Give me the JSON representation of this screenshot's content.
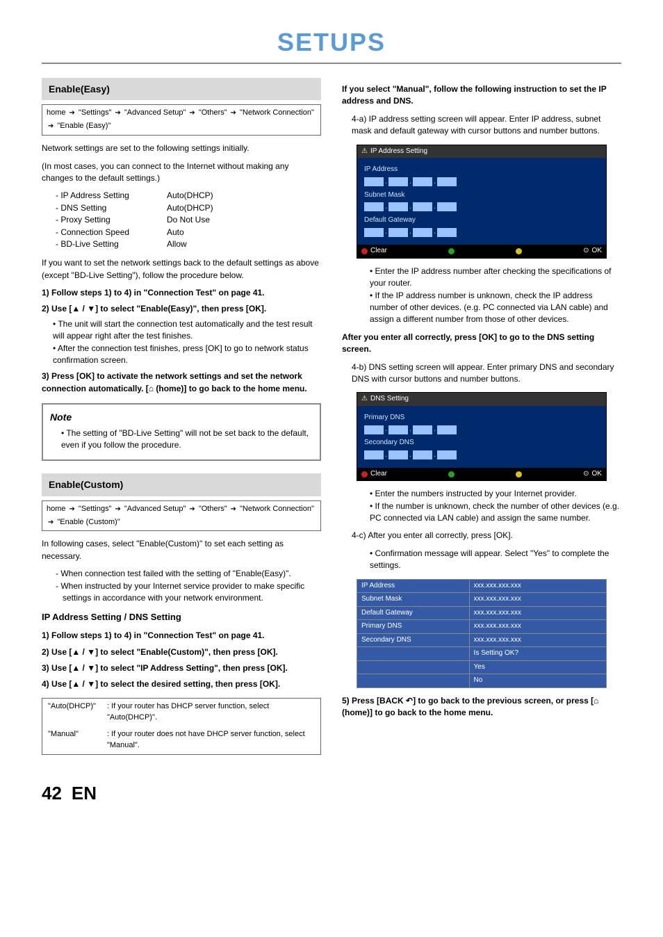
{
  "page": {
    "title": "SETUPS",
    "number": "42",
    "lang": "EN"
  },
  "left": {
    "sec1": {
      "header": "Enable(Easy)",
      "crumb": [
        "home",
        "\"Settings\"",
        "\"Advanced Setup\"",
        "\"Others\"",
        "\"Network Connection\"",
        "\"Enable (Easy)\""
      ],
      "intro1": "Network settings are set to the following settings initially.",
      "intro2": "(In most cases, you can connect to the Internet without making any changes to the default settings.)",
      "defaults": [
        {
          "n": "- IP Address Setting",
          "v": "Auto(DHCP)"
        },
        {
          "n": "- DNS Setting",
          "v": "Auto(DHCP)"
        },
        {
          "n": "- Proxy Setting",
          "v": "Do Not Use"
        },
        {
          "n": "- Connection Speed",
          "v": "Auto"
        },
        {
          "n": "- BD-Live Setting",
          "v": "Allow"
        }
      ],
      "reset": "If you want to set the network settings back to the default settings as above (except \"BD-Live Setting\"), follow the procedure below.",
      "step1": "1)  Follow steps 1) to 4) in \"Connection Test\" on page 41.",
      "step2": "2)  Use [▲ / ▼] to select \"Enable(Easy)\", then press [OK].",
      "step2_bullets": [
        "The unit will start the connection test automatically and the test result will appear right after the test finishes.",
        "After the connection test finishes, press [OK] to go to network status confirmation screen."
      ],
      "step3": "3)  Press [OK] to activate the network settings and set the network connection automatically. [⌂ (home)] to go back to the home menu.",
      "note_title": "Note",
      "note_body": "The setting of \"BD-Live Setting\" will not be set back to the default, even if you follow the procedure."
    },
    "sec2": {
      "header": "Enable(Custom)",
      "crumb": [
        "home",
        "\"Settings\"",
        "\"Advanced Setup\"",
        "\"Others\"",
        "\"Network Connection\"",
        "\"Enable (Custom)\""
      ],
      "intro": "In following cases, select \"Enable(Custom)\" to set each setting as necessary.",
      "cases": [
        "- When connection test failed with the setting of \"Enable(Easy)\".",
        "- When instructed by your Internet service provider to make specific settings in accordance with your network environment."
      ],
      "subhead": "IP Address Setting / DNS Setting",
      "s1": "1)  Follow steps 1) to 4) in \"Connection Test\" on page 41.",
      "s2": "2)  Use [▲ / ▼] to select \"Enable(Custom)\", then press [OK].",
      "s3": "3)  Use [▲ / ▼] to select \"IP Address Setting\", then press [OK].",
      "s4": "4)  Use [▲ / ▼] to select the desired setting, then press [OK].",
      "table": [
        {
          "k": "\"Auto(DHCP)\"",
          "v": ": If your router has DHCP server function, select \"Auto(DHCP)\"."
        },
        {
          "k": "\"Manual\"",
          "v": ": If your router does not have DHCP server function, select \"Manual\"."
        }
      ]
    }
  },
  "right": {
    "manual_head": "If you select \"Manual\", follow the following instruction to set the IP address and DNS.",
    "s4a": "4-a) IP address setting screen will appear. Enter IP address, subnet mask and default gateway with cursor buttons and number buttons.",
    "ip_osd": {
      "title": "IP Address Setting",
      "labels": [
        "IP Address",
        "Subnet Mask",
        "Default Gateway"
      ],
      "footer_clear": "Clear",
      "footer_ok": "OK"
    },
    "ip_bullets": [
      "Enter the IP address number after checking the specifications of your router.",
      "If the IP address number is unknown, check the IP address number of other devices. (e.g. PC connected via LAN cable) and assign a different number from those of other devices."
    ],
    "after_ip": "After you enter all correctly, press [OK] to go to the DNS setting screen.",
    "s4b": "4-b) DNS setting screen will appear. Enter primary DNS and secondary DNS with cursor buttons and number buttons.",
    "dns_osd": {
      "title": "DNS Setting",
      "labels": [
        "Primary DNS",
        "Secondary DNS"
      ],
      "footer_clear": "Clear",
      "footer_ok": "OK"
    },
    "dns_bullets": [
      "Enter the numbers instructed by your Internet provider.",
      "If the number is unknown, check the number of other devices (e.g. PC connected via LAN cable) and assign the same number."
    ],
    "s4c_head": "4-c) After you enter all correctly, press [OK].",
    "s4c_bullet": "Confirmation message will appear. Select \"Yes\" to complete the settings.",
    "confirm_table": [
      {
        "k": "IP Address",
        "v": "xxx.xxx.xxx.xxx"
      },
      {
        "k": "Subnet Mask",
        "v": "xxx.xxx.xxx.xxx"
      },
      {
        "k": "Default Gateway",
        "v": "xxx.xxx.xxx.xxx"
      },
      {
        "k": "Primary DNS",
        "v": "xxx.xxx.xxx.xxx"
      },
      {
        "k": "Secondary DNS",
        "v": "xxx.xxx.xxx.xxx"
      },
      {
        "k": "",
        "v": "Is Setting OK?"
      },
      {
        "k": "",
        "v": "Yes"
      },
      {
        "k": "",
        "v": "No"
      }
    ],
    "s5": "5)  Press [BACK ↶] to go back to the previous screen, or press [⌂ (home)] to go back to the home menu."
  }
}
